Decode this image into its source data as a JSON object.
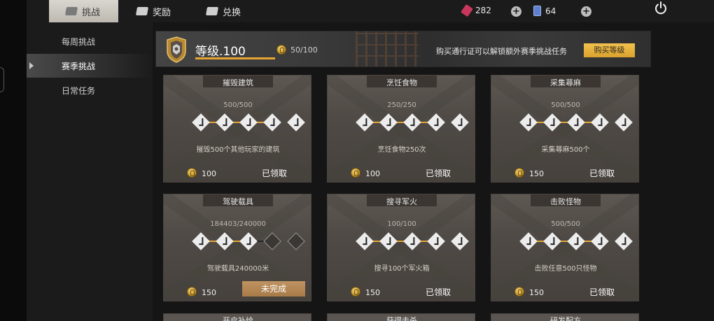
{
  "tabs": [
    {
      "label": "挑战",
      "active": true
    },
    {
      "label": "奖励",
      "active": false
    },
    {
      "label": "兑换",
      "active": false
    }
  ],
  "resources": {
    "tickets": "282",
    "cards": "64"
  },
  "sidebar": {
    "items": [
      {
        "label": "每周挑战",
        "active": false
      },
      {
        "label": "赛季挑战",
        "active": true
      },
      {
        "label": "日常任务",
        "active": false
      }
    ]
  },
  "banner": {
    "level": "等级.100",
    "progress": "50/100",
    "hint": "购买通行证可以解锁额外赛季挑战任务",
    "buy_label": "购买等级"
  },
  "tasks": [
    {
      "title": "摧毁建筑",
      "count": "500/500",
      "desc": "摧毁500个其他玩家的建筑",
      "reward": "100",
      "status": "已领取",
      "completed_steps": 5,
      "total_steps": 5
    },
    {
      "title": "烹饪食物",
      "count": "250/250",
      "desc": "烹饪食物250次",
      "reward": "100",
      "status": "已领取",
      "completed_steps": 5,
      "total_steps": 5
    },
    {
      "title": "采集蕁麻",
      "count": "500/500",
      "desc": "采集蕁麻500个",
      "reward": "150",
      "status": "已领取",
      "completed_steps": 5,
      "total_steps": 5
    },
    {
      "title": "驾驶载具",
      "count": "184403/240000",
      "desc": "驾驶载具240000米",
      "reward": "150",
      "status": "未完成",
      "completed_steps": 3,
      "total_steps": 5
    },
    {
      "title": "搜寻军火",
      "count": "100/100",
      "desc": "搜寻100个军火箱",
      "reward": "150",
      "status": "已领取",
      "completed_steps": 5,
      "total_steps": 5
    },
    {
      "title": "击败怪物",
      "count": "500/500",
      "desc": "击败任意500只怪物",
      "reward": "150",
      "status": "已领取",
      "completed_steps": 5,
      "total_steps": 5
    }
  ],
  "peek_tasks": [
    {
      "title": "开启补给"
    },
    {
      "title": "获得击杀"
    },
    {
      "title": "研发配方"
    }
  ],
  "colors": {
    "accent": "#e6a531",
    "buy_button": "#f2c14e",
    "incomplete_button": "#b3875a"
  }
}
